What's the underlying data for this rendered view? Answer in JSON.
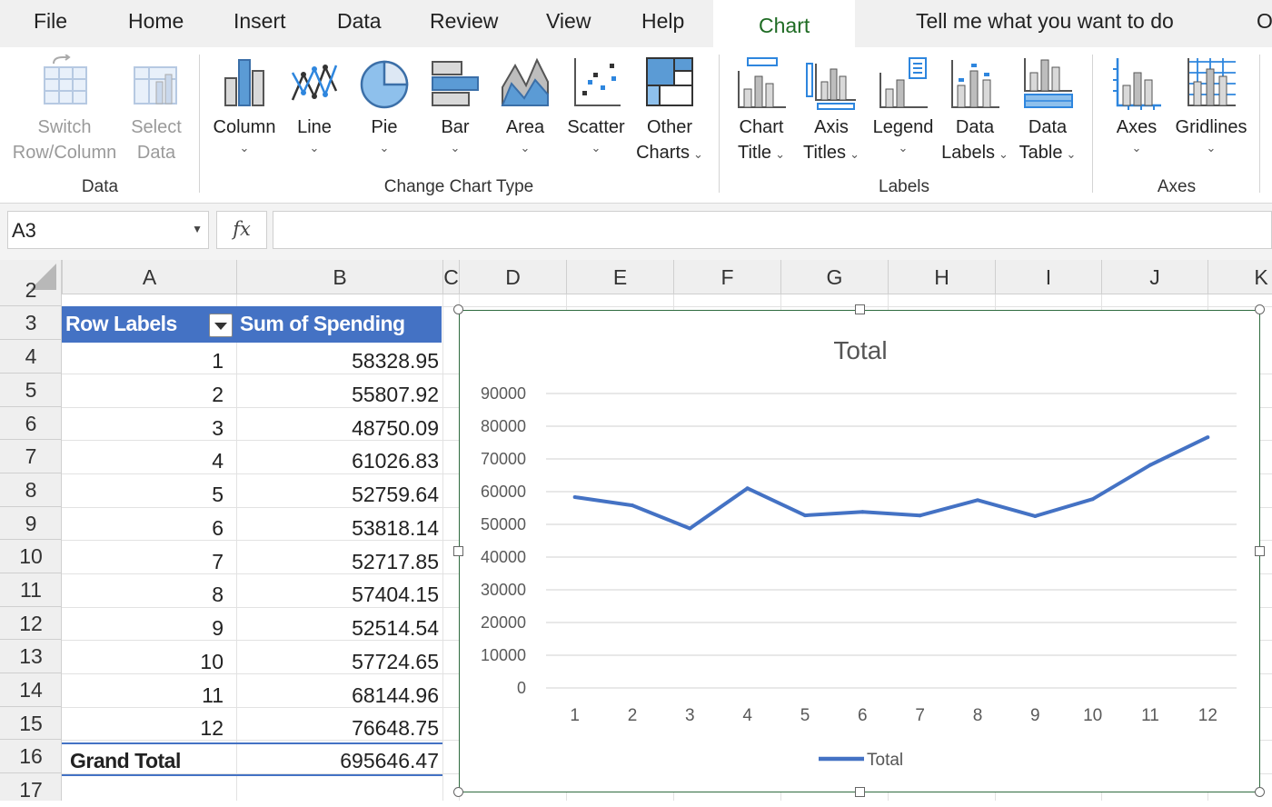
{
  "ribbon_tabs": [
    "File",
    "Home",
    "Insert",
    "Data",
    "Review",
    "View",
    "Help",
    "Chart",
    "Tell me what you want to do",
    "O"
  ],
  "active_tab": "Chart",
  "ribbon": {
    "switch_l1": "Switch",
    "switch_l2": "Row/Column",
    "select_l1": "Select",
    "select_l2": "Data",
    "group_data": "Data",
    "column": "Column",
    "line": "Line",
    "pie": "Pie",
    "bar": "Bar",
    "area": "Area",
    "scatter": "Scatter",
    "other_l1": "Other",
    "other_l2": "Charts",
    "group_change": "Change Chart Type",
    "charttitle_l1": "Chart",
    "charttitle_l2": "Title",
    "axistitles_l1": "Axis",
    "axistitles_l2": "Titles",
    "legend": "Legend",
    "datalabels_l1": "Data",
    "datalabels_l2": "Labels",
    "datatable_l1": "Data",
    "datatable_l2": "Table",
    "group_labels": "Labels",
    "axes": "Axes",
    "gridlines": "Gridlines",
    "group_axes": "Axes"
  },
  "formula_bar": {
    "name_box": "A3",
    "fx": "fx",
    "formula": ""
  },
  "columns": [
    "A",
    "B",
    "C",
    "D",
    "E",
    "F",
    "G",
    "H",
    "I",
    "J",
    "K"
  ],
  "rows": [
    "2",
    "3",
    "4",
    "5",
    "6",
    "7",
    "8",
    "9",
    "10",
    "11",
    "12",
    "13",
    "14",
    "15",
    "16",
    "17"
  ],
  "pivot": {
    "header_row_labels": "Row Labels",
    "header_sum": "Sum of Spending",
    "rows": [
      {
        "label": "1",
        "value": "58328.95"
      },
      {
        "label": "2",
        "value": "55807.92"
      },
      {
        "label": "3",
        "value": "48750.09"
      },
      {
        "label": "4",
        "value": "61026.83"
      },
      {
        "label": "5",
        "value": "52759.64"
      },
      {
        "label": "6",
        "value": "53818.14"
      },
      {
        "label": "7",
        "value": "52717.85"
      },
      {
        "label": "8",
        "value": "57404.15"
      },
      {
        "label": "9",
        "value": "52514.54"
      },
      {
        "label": "10",
        "value": "57724.65"
      },
      {
        "label": "11",
        "value": "68144.96"
      },
      {
        "label": "12",
        "value": "76648.75"
      }
    ],
    "grand_total_label": "Grand Total",
    "grand_total_value": "695646.47"
  },
  "chart_data": {
    "type": "line",
    "title": "Total",
    "categories": [
      "1",
      "2",
      "3",
      "4",
      "5",
      "6",
      "7",
      "8",
      "9",
      "10",
      "11",
      "12"
    ],
    "series": [
      {
        "name": "Total",
        "values": [
          58328.95,
          55807.92,
          48750.09,
          61026.83,
          52759.64,
          53818.14,
          52717.85,
          57404.15,
          52514.54,
          57724.65,
          68144.96,
          76648.75
        ]
      }
    ],
    "yticks": [
      "0",
      "10000",
      "20000",
      "30000",
      "40000",
      "50000",
      "60000",
      "70000",
      "80000",
      "90000"
    ],
    "ylim": [
      0,
      90000
    ],
    "grid": true,
    "legend": "bottom",
    "color": "#4472c4"
  }
}
